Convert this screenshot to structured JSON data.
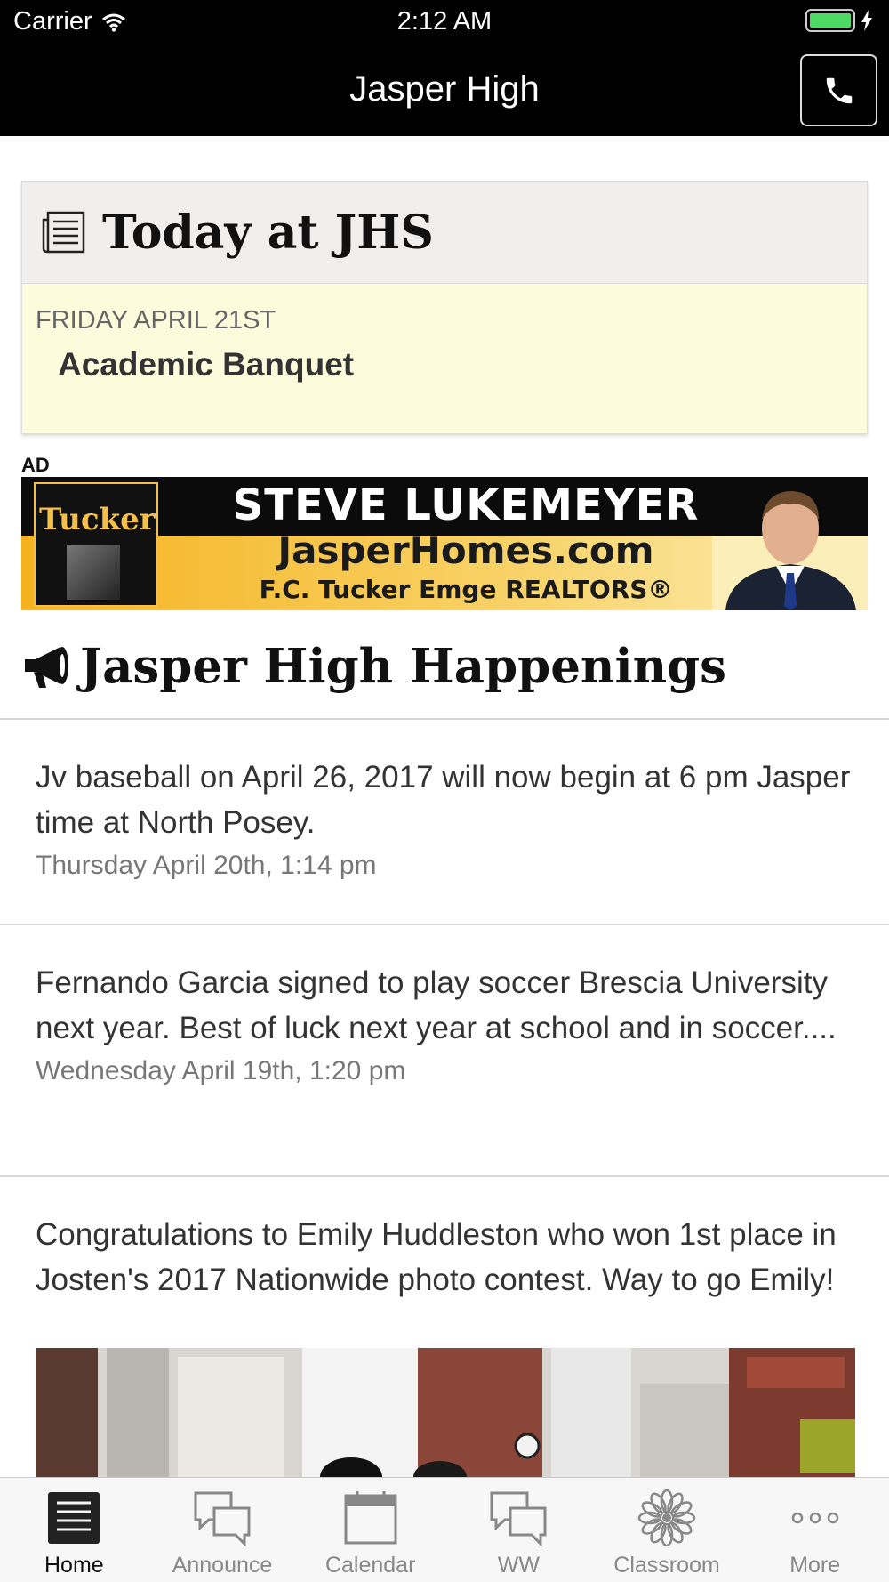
{
  "status_bar": {
    "carrier": "Carrier",
    "time": "2:12 AM"
  },
  "nav": {
    "title": "Jasper High",
    "phone_icon": "phone-icon"
  },
  "today": {
    "title": "Today at JHS",
    "icon": "newspaper-icon",
    "date": "FRIDAY APRIL 21ST",
    "event": "Academic Banquet"
  },
  "ad": {
    "label": "AD",
    "logo_text": "Tucker",
    "name": "STEVE LUKEMEYER",
    "site": "JasperHomes.com",
    "firm": "F.C. Tucker Emge REALTORS®"
  },
  "happenings": {
    "title": "Jasper High Happenings",
    "icon": "megaphone-icon",
    "items": [
      {
        "text": "Jv baseball on April 26, 2017 will now begin at 6 pm Jasper time at North Posey.",
        "time": "Thursday April 20th, 1:14 pm"
      },
      {
        "text": "Fernando Garcia signed to play soccer Brescia University next year. Best of luck next year at school and in soccer....",
        "time": "Wednesday April 19th, 1:20 pm"
      },
      {
        "text": "Congratulations to Emily Huddleston who won 1st place in Josten's 2017 Nationwide photo contest. Way to go Emily!"
      }
    ]
  },
  "tabs": [
    {
      "label": "Home",
      "icon": "home-list-icon",
      "active": true
    },
    {
      "label": "Announce",
      "icon": "chat-bubbles-icon",
      "active": false
    },
    {
      "label": "Calendar",
      "icon": "calendar-icon",
      "active": false
    },
    {
      "label": "WW",
      "icon": "chat-bubbles-icon",
      "active": false
    },
    {
      "label": "Classroom",
      "icon": "flower-icon",
      "active": false
    },
    {
      "label": "More",
      "icon": "ellipsis-icon",
      "active": false
    }
  ],
  "colors": {
    "nav_bg": "#000000",
    "today_body": "#fcfbdc",
    "today_head": "#f1efed",
    "battery": "#4cd964"
  }
}
